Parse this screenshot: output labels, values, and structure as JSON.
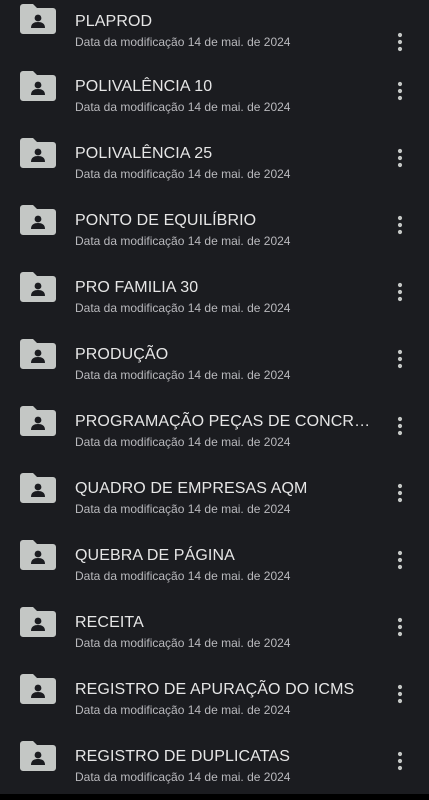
{
  "files": [
    {
      "title": "PLAPROD",
      "subtitle": "Data da modificação 14 de mai. de 2024"
    },
    {
      "title": "POLIVALÊNCIA 10",
      "subtitle": "Data da modificação 14 de mai. de 2024"
    },
    {
      "title": "POLIVALÊNCIA 25",
      "subtitle": "Data da modificação 14 de mai. de 2024"
    },
    {
      "title": "PONTO DE EQUILÍBRIO",
      "subtitle": "Data da modificação 14 de mai. de 2024"
    },
    {
      "title": "PRO FAMILIA 30",
      "subtitle": "Data da modificação 14 de mai. de 2024"
    },
    {
      "title": "PRODUÇÃO",
      "subtitle": "Data da modificação 14 de mai. de 2024"
    },
    {
      "title": "PROGRAMAÇÃO PEÇAS DE CONCR…",
      "subtitle": "Data da modificação 14 de mai. de 2024"
    },
    {
      "title": "QUADRO DE EMPRESAS AQM",
      "subtitle": "Data da modificação 14 de mai. de 2024"
    },
    {
      "title": "QUEBRA DE PÁGINA",
      "subtitle": "Data da modificação 14 de mai. de 2024"
    },
    {
      "title": "RECEITA",
      "subtitle": "Data da modificação 14 de mai. de 2024"
    },
    {
      "title": "REGISTRO DE APURAÇÃO DO ICMS",
      "subtitle": "Data da modificação 14 de mai. de 2024"
    },
    {
      "title": "REGISTRO DE DUPLICATAS",
      "subtitle": "Data da modificação 14 de mai. de 2024"
    }
  ],
  "icons": {
    "folder": "shared-folder-icon",
    "more": "more-vert-icon"
  },
  "colors": {
    "background": "#1b1c20",
    "title": "#e6e6e6",
    "subtitle": "#b9b9bd",
    "icon": "#c4c7c5"
  }
}
